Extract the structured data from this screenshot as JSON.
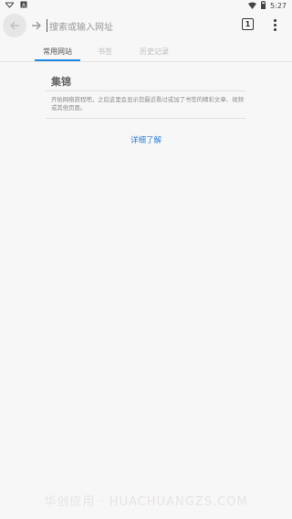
{
  "status_bar": {
    "left_icons": [
      "notification-icon",
      "a-icon"
    ],
    "time": "5:27",
    "right_icons": [
      "wifi-icon",
      "battery-icon"
    ]
  },
  "toolbar": {
    "url_placeholder": "搜索或输入网址",
    "tab_count": "1"
  },
  "tabs": [
    {
      "label": "常用网站",
      "active": true
    },
    {
      "label": "书签",
      "active": false
    },
    {
      "label": "历史记录",
      "active": false
    }
  ],
  "collections": {
    "title": "集锦",
    "description": "开始网络旅程吧，之后这里会显示您最近看过或加了书签的精彩文章、视频或其他页面。",
    "learn_more": "详细了解"
  },
  "watermark": "华创应用 · HUACHUANGZS.COM",
  "colors": {
    "accent": "#1e88e5",
    "link": "#2a7fd4",
    "background": "#f7f7f7"
  }
}
